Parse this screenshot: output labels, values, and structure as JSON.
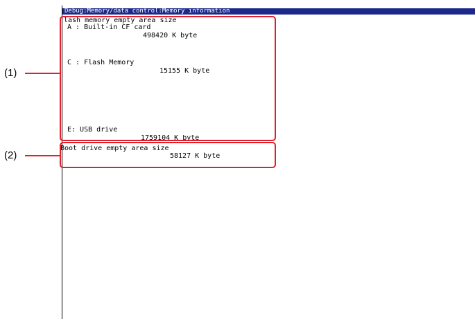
{
  "window": {
    "title": "Debug:Memory/data control:Memory information"
  },
  "flash_section": {
    "heading": "lash memory empty area size",
    "items": [
      {
        "label": "A : Built-in CF card",
        "value": "498420 K byte"
      },
      {
        "label": "C : Flash Memory",
        "value": "15155 K byte"
      },
      {
        "label": "E: USB drive",
        "value": "1759104 K byte"
      }
    ]
  },
  "boot_section": {
    "heading": "Boot drive empty area size",
    "value": "58127 K byte"
  },
  "callouts": {
    "c1": "(1)",
    "c2": "(2)"
  },
  "colors": {
    "title_bar": "#1b2a8a",
    "callout": "#e0202a"
  }
}
